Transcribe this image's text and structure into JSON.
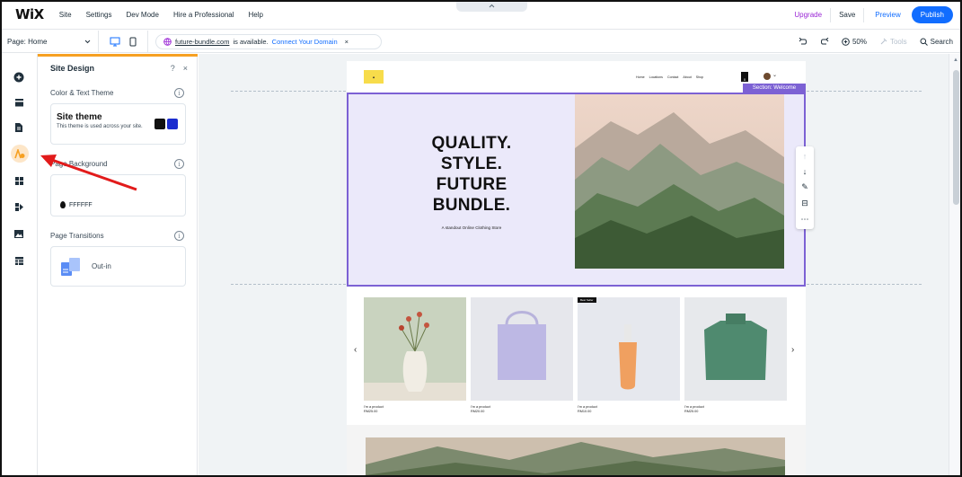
{
  "topbar": {
    "logo": "WiX",
    "menu": [
      "Site",
      "Settings",
      "Dev Mode",
      "Hire a Professional",
      "Help"
    ],
    "upgrade": "Upgrade",
    "save": "Save",
    "preview": "Preview",
    "publish": "Publish",
    "collapse_icon": "chevron-up-icon"
  },
  "bar2": {
    "page_label": "Page: Home",
    "domain": "future-bundle.com",
    "available_text": "is available.",
    "connect": "Connect Your Domain",
    "zoom": "50%",
    "tools": "Tools",
    "search": "Search"
  },
  "panel": {
    "title": "Site Design",
    "help": "?",
    "close": "×",
    "color_text_theme": "Color & Text Theme",
    "theme_title": "Site theme",
    "theme_desc": "This theme is used across your site.",
    "theme_colors": [
      "#111111",
      "#1a2ccf"
    ],
    "page_background": "Page Background",
    "bg_color": "FFFFFF",
    "page_transitions": "Page Transitions",
    "transition_value": "Out-in"
  },
  "site": {
    "nav": [
      "Home",
      "Locations",
      "Contact",
      "About",
      "Shop"
    ],
    "cart_count": "0",
    "section_tag": "Section: Welcome",
    "hero_title": [
      "QUALITY.",
      "STYLE.",
      "FUTURE",
      "BUNDLE."
    ],
    "hero_sub": "A standout Online Clothing Store",
    "products": [
      {
        "name": "I'm a product",
        "price": "RM25.00",
        "badge": ""
      },
      {
        "name": "I'm a product",
        "price": "RM20.00",
        "badge": ""
      },
      {
        "name": "I'm a product",
        "price": "RM10.00",
        "badge": "Best Seller"
      },
      {
        "name": "I'm a product",
        "price": "RM25.00",
        "badge": ""
      }
    ]
  },
  "colors": {
    "accent": "#116dff",
    "upgrade": "#9a27d5",
    "panel_accent": "#f6a022",
    "selection": "#7c61d4",
    "annotation": "#e21b1b"
  }
}
